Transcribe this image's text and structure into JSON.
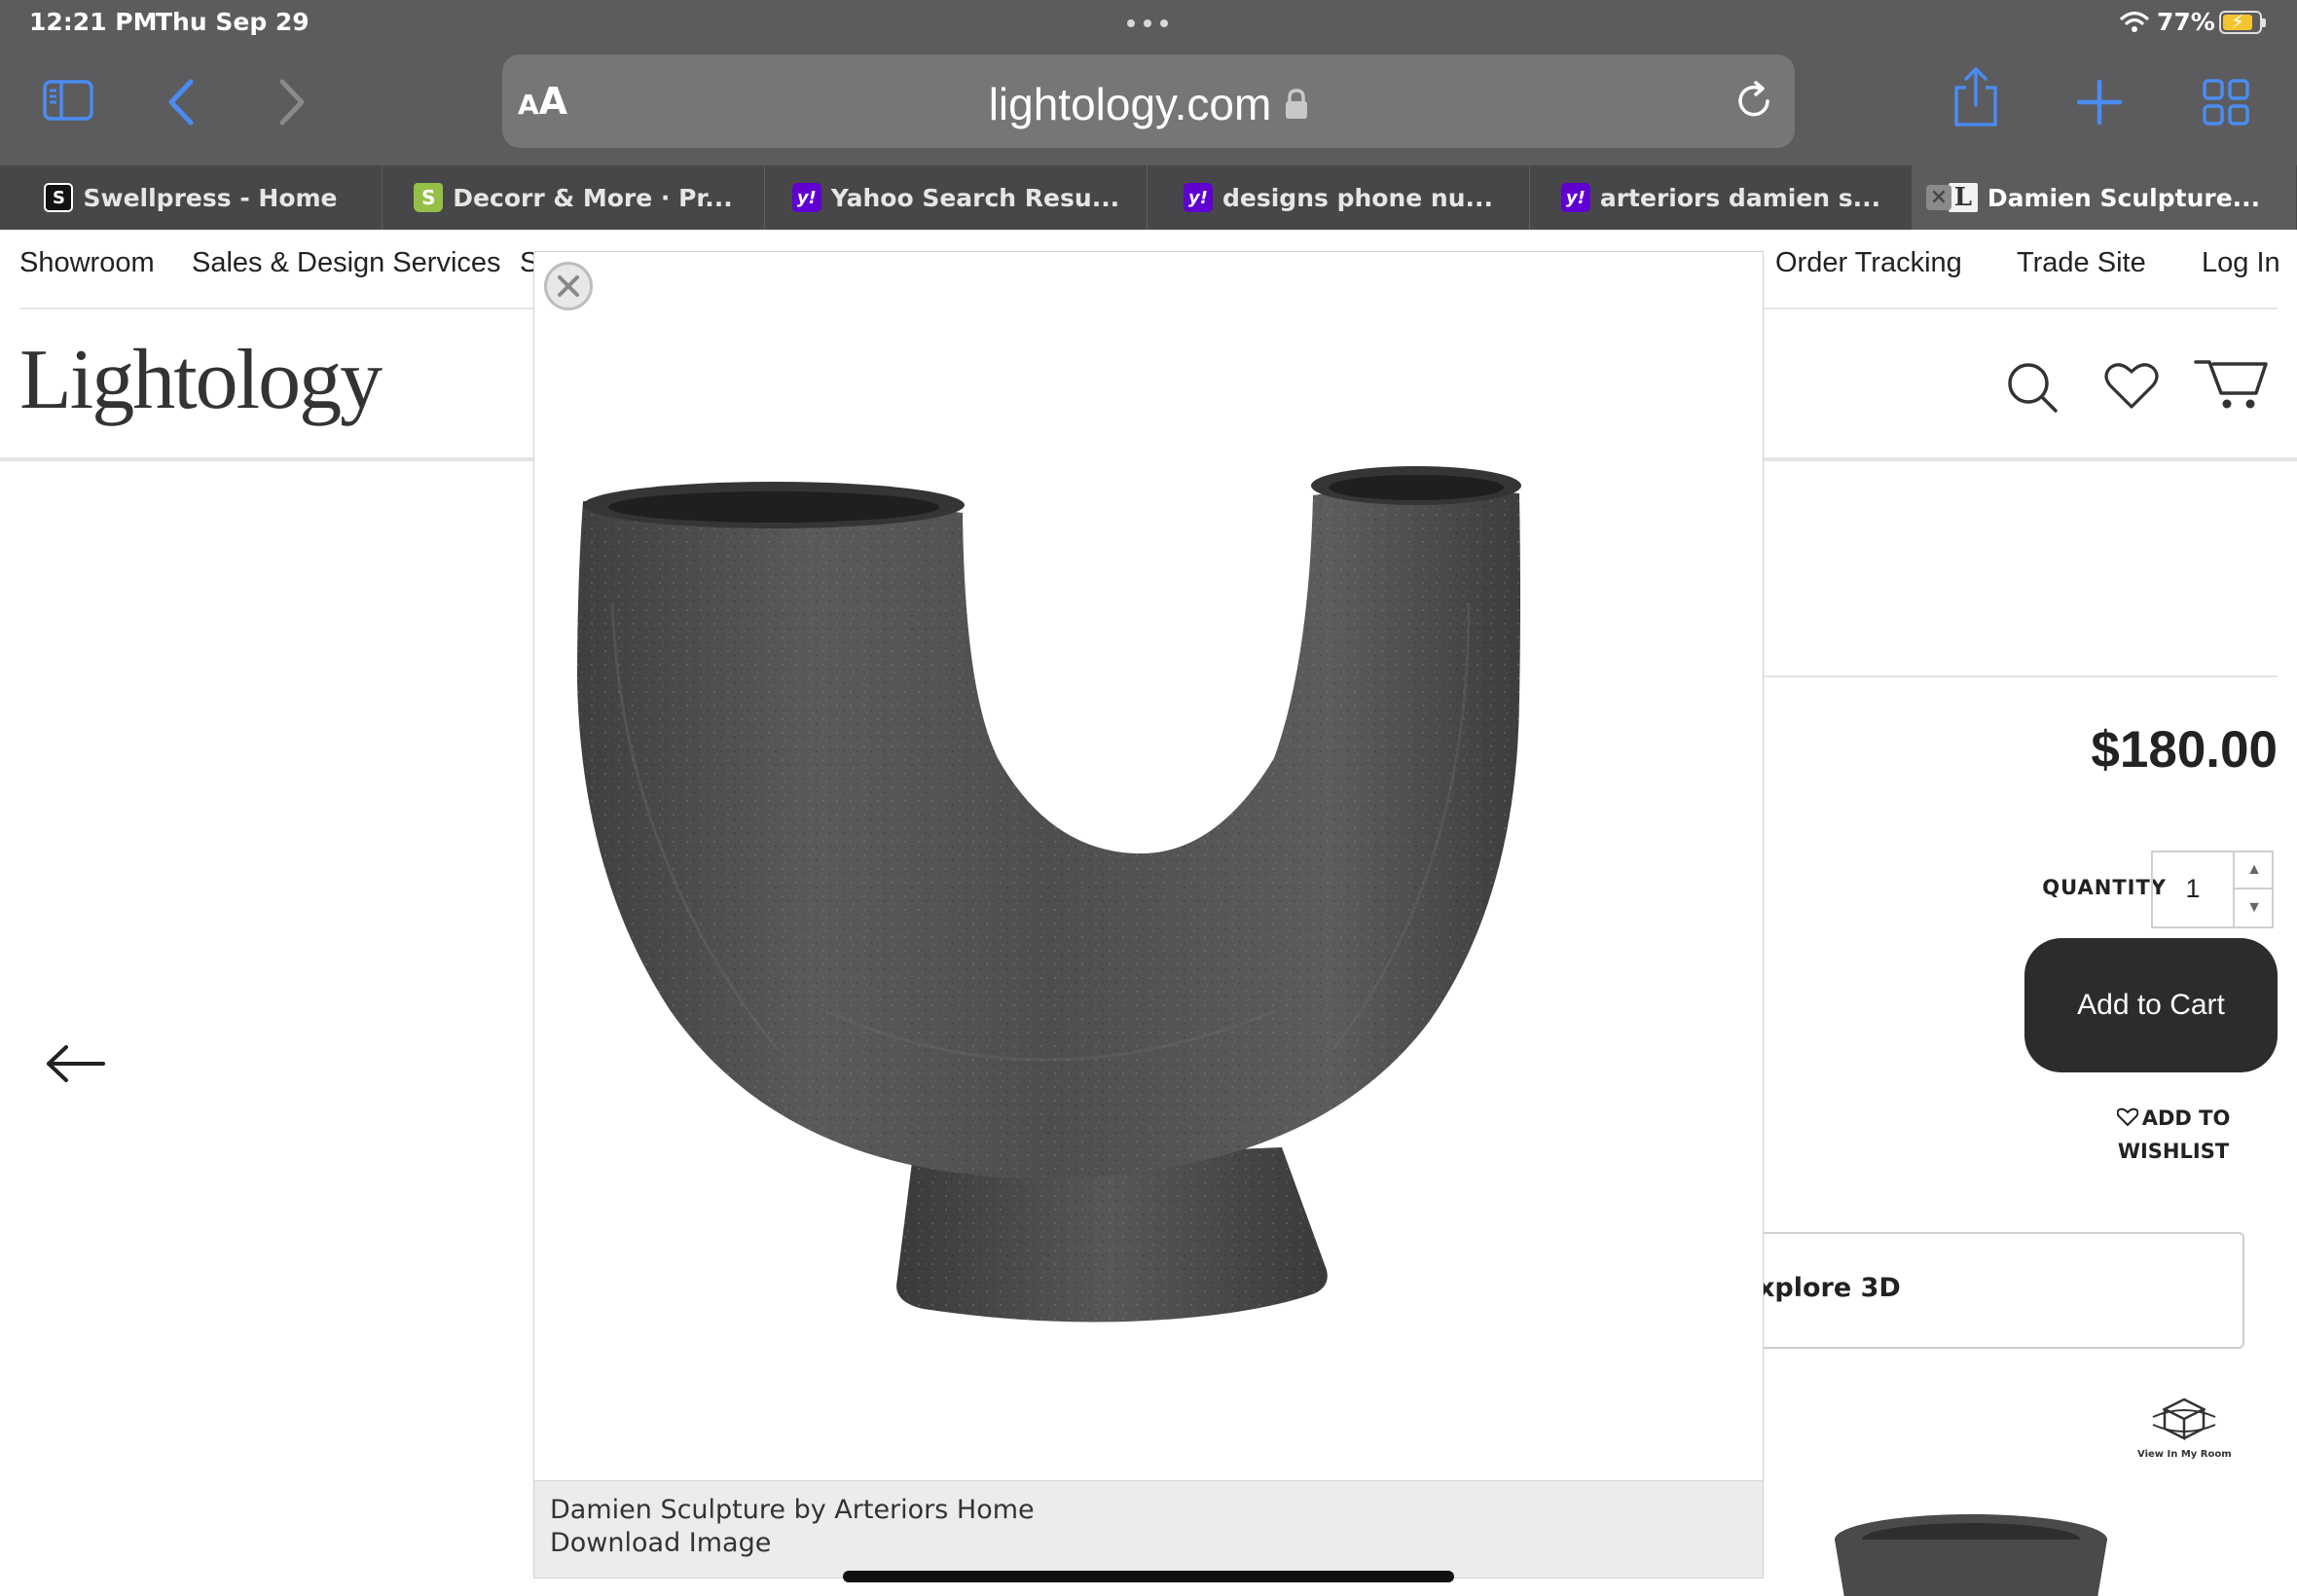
{
  "status_bar": {
    "time": "12:21 PM",
    "date": "Thu Sep 29",
    "battery": "77%"
  },
  "toolbar": {
    "text_size_label_small": "A",
    "text_size_label_big": "A",
    "url": "lightology.com"
  },
  "tabs": [
    {
      "label": "Swellpress - Home",
      "favicon": "S",
      "favicon_style": "s"
    },
    {
      "label": "Decorr & More · Pr...",
      "favicon": "S",
      "favicon_style": "shop"
    },
    {
      "label": "Yahoo Search Resu...",
      "favicon": "y!",
      "favicon_style": "yahoo"
    },
    {
      "label": "designs phone nu...",
      "favicon": "y!",
      "favicon_style": "yahoo"
    },
    {
      "label": "arteriors damien s...",
      "favicon": "y!",
      "favicon_style": "yahoo"
    },
    {
      "label": "Damien Sculpture...",
      "favicon": "L",
      "favicon_style": "l",
      "active": true
    }
  ],
  "site": {
    "nav": {
      "showroom": "Showroom",
      "sales": "Sales & Design Services",
      "partial": "S",
      "order_tracking": "Order Tracking",
      "trade_site": "Trade Site",
      "login": "Log In"
    },
    "logo": "Lightology",
    "price": "$180.00",
    "quantity_label": "QUANTITY",
    "quantity_value": "1",
    "add_to_cart": "Add to Cart",
    "wishlist_line1": "ADD TO",
    "wishlist_line2": "WISHLIST",
    "explore_label": "xplore 3D",
    "view_in_room": "View In My Room"
  },
  "modal": {
    "caption_title": "Damien Sculpture by Arteriors Home",
    "download_label": "Download Image"
  },
  "colors": {
    "chrome_bg": "#5c5c5e",
    "tab_bar_bg": "#474749",
    "accent_blue": "#4a8cf0",
    "cart_button": "#2c2c2c"
  }
}
